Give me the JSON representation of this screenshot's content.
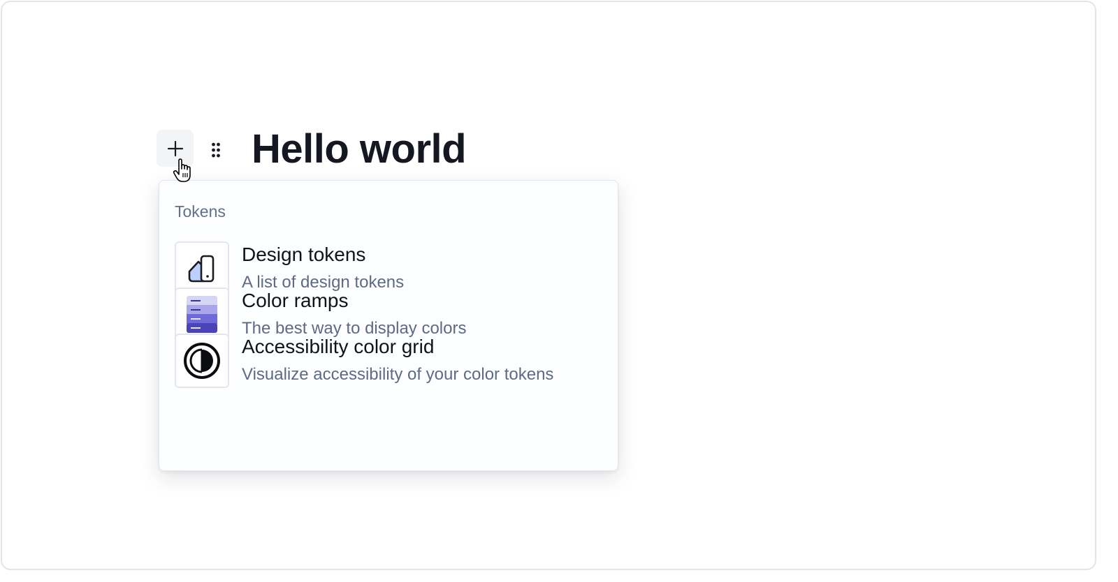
{
  "editor": {
    "heading": "Hello world",
    "add_block_icon": "plus-icon",
    "drag_handle_icon": "drag-dots-icon",
    "cursor_icon": "hand-pointer-icon"
  },
  "insert_menu": {
    "section_label": "Tokens",
    "items": [
      {
        "title": "Design tokens",
        "description": "A list of design tokens",
        "icon": "swatches-icon"
      },
      {
        "title": "Color ramps",
        "description": "The best way to display colors",
        "icon": "color-ramp-icon"
      },
      {
        "title": "Accessibility color grid",
        "description": "Visualize accessibility of your color tokens",
        "icon": "contrast-icon"
      }
    ]
  },
  "colors": {
    "heading": "#151821",
    "muted_text": "#5e6a85",
    "swatch_fill": "#bcd0ff",
    "ramp_1": "#d6d5f5",
    "ramp_2": "#a9a6ec",
    "ramp_3": "#6f6ad9",
    "ramp_4": "#4a44b8"
  }
}
